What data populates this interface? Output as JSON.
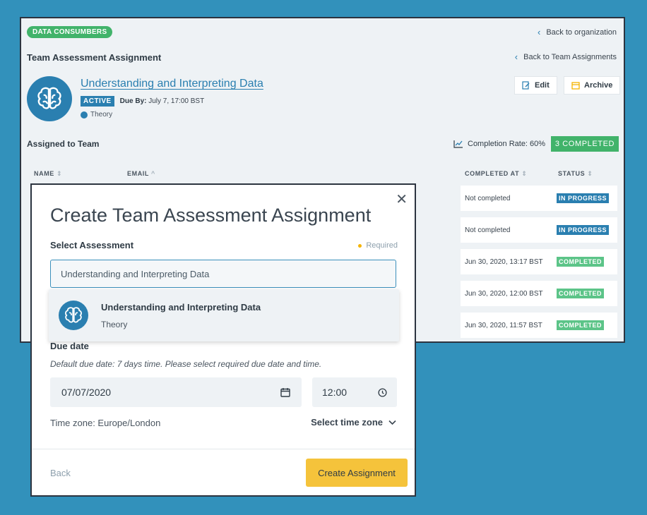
{
  "header": {
    "tag": "DATA CONSUMBERS",
    "back_org": "Back to organization",
    "back_assign": "Back to Team Assignments",
    "title": "Team Assessment Assignment"
  },
  "course": {
    "title": "Understanding and Interpreting Data",
    "status": "ACTIVE",
    "due_label": "Due By:",
    "due_value": "July 7, 17:00 BST",
    "type": "Theory"
  },
  "actions": {
    "edit": "Edit",
    "archive": "Archive"
  },
  "team": {
    "assigned_label": "Assigned to Team",
    "completion_rate": "Completion Rate: 60%",
    "completed_count": "3 COMPLETED"
  },
  "table": {
    "headers": {
      "name": "NAME",
      "email": "EMAIL",
      "completed_at": "COMPLETED AT",
      "status": "STATUS"
    },
    "rows": [
      {
        "completed_at": "Not completed",
        "status": "IN PROGRESS"
      },
      {
        "completed_at": "Not completed",
        "status": "IN PROGRESS"
      },
      {
        "completed_at": "Jun 30, 2020, 13:17 BST",
        "status": "COMPLETED"
      },
      {
        "completed_at": "Jun 30, 2020, 12:00 BST",
        "status": "COMPLETED"
      },
      {
        "completed_at": "Jun 30, 2020, 11:57 BST",
        "status": "COMPLETED"
      }
    ]
  },
  "modal": {
    "title": "Create Team Assessment Assignment",
    "select_label": "Select Assessment",
    "required": "Required",
    "search_value": "Understanding and Interpreting Data",
    "option_title": "Understanding and Interpreting Data",
    "option_sub": "Theory",
    "due_label": "Due date",
    "due_hint": "Default due date: 7 days time. Please select required due date and time.",
    "date_value": "07/07/2020",
    "time_value": "12:00",
    "timezone": "Time zone: Europe/London",
    "select_tz": "Select time zone",
    "back": "Back",
    "create": "Create Assignment"
  },
  "colors": {
    "accent": "#2a7fb0",
    "success": "#41b36a",
    "primary_button": "#f5c33b",
    "background": "#3291bb"
  }
}
